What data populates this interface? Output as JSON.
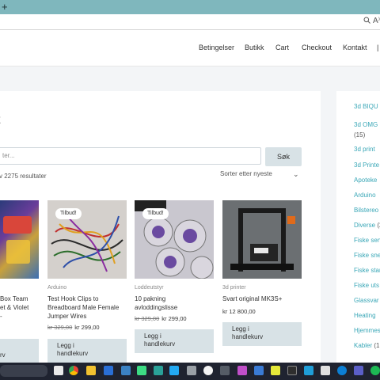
{
  "browser": {
    "new_tab_glyph": "+",
    "addressbar_icons": [
      "zoom-icon",
      "reader-icon"
    ],
    "reader_glyph": "A⁾"
  },
  "header": {
    "nav": [
      "Betingelser",
      "Butikk",
      "Cart",
      "Checkout",
      "Kontakt"
    ]
  },
  "main": {
    "title": "t",
    "search_placeholder": "ter...",
    "search_button": "Søk",
    "result_count": "v 2275 resultater",
    "sort_selected": "Sorter etter nyeste"
  },
  "products": [
    {
      "category": "",
      "title_lines": [
        "Box Team",
        "et & Violet",
        "-"
      ],
      "price": "",
      "old_price": "",
      "badge": "",
      "button": [
        "rv"
      ]
    },
    {
      "category": "Arduino",
      "title_lines": [
        "Test Hook Clips to",
        "Breadboard Male Female",
        "Jumper Wires"
      ],
      "old_price": "kr 329,00",
      "price": "kr 299,00",
      "badge": "Tilbud!",
      "button": [
        "Legg i",
        "handlekurv"
      ]
    },
    {
      "category": "Loddeutstyr",
      "title_lines": [
        "10 pakning",
        "avloddingslisse"
      ],
      "old_price": "kr 329,00",
      "price": "kr 299,00",
      "badge": "Tilbud!",
      "button": [
        "Legg i",
        "handlekurv"
      ]
    },
    {
      "category": "3d printer",
      "title_lines": [
        "Svart original MK3S+"
      ],
      "old_price": "",
      "price": "kr 12 800,00",
      "badge": "",
      "button": [
        "Legg i",
        "handlekurv"
      ]
    }
  ],
  "sidebar": {
    "items": [
      {
        "label": "3d BIQU",
        "count": ""
      },
      {
        "label": "3d OMG",
        "count": "(15)"
      },
      {
        "label": "3d print",
        "count": ""
      },
      {
        "label": "3d Printe",
        "count": ""
      },
      {
        "label": "Apoteke",
        "count": ""
      },
      {
        "label": "Arduino",
        "count": ""
      },
      {
        "label": "Bilstereo",
        "count": ""
      },
      {
        "label": "Diverse",
        "count": "(2"
      },
      {
        "label": "Fiske sen",
        "count": ""
      },
      {
        "label": "Fiske sne",
        "count": ""
      },
      {
        "label": "Fiske stan",
        "count": ""
      },
      {
        "label": "Fiske uts",
        "count": ""
      },
      {
        "label": "Glassvar",
        "count": ""
      },
      {
        "label": "Heating",
        "count": ""
      },
      {
        "label": "Hjemmes",
        "count": ""
      },
      {
        "label": "Kabler",
        "count": "(1"
      }
    ]
  },
  "taskbar": {
    "icons": [
      "start-icon",
      "search-icon",
      "task-view-icon",
      "chrome-icon",
      "explorer-icon",
      "mail-icon",
      "app-icon",
      "camera-icon",
      "android-studio-icon",
      "app2-icon",
      "vscode-icon",
      "app3-icon",
      "github-icon",
      "app4-icon",
      "app5-icon",
      "notes-icon",
      "app6-icon",
      "terminal-icon",
      "edge-icon",
      "app7-icon",
      "spotify-icon"
    ],
    "colors": {
      "background": "#1f2330"
    }
  },
  "colors": {
    "accent_link": "#3aa7b7",
    "button_bg": "#d8e2e6",
    "tabstrip": "#7fb7bd"
  }
}
